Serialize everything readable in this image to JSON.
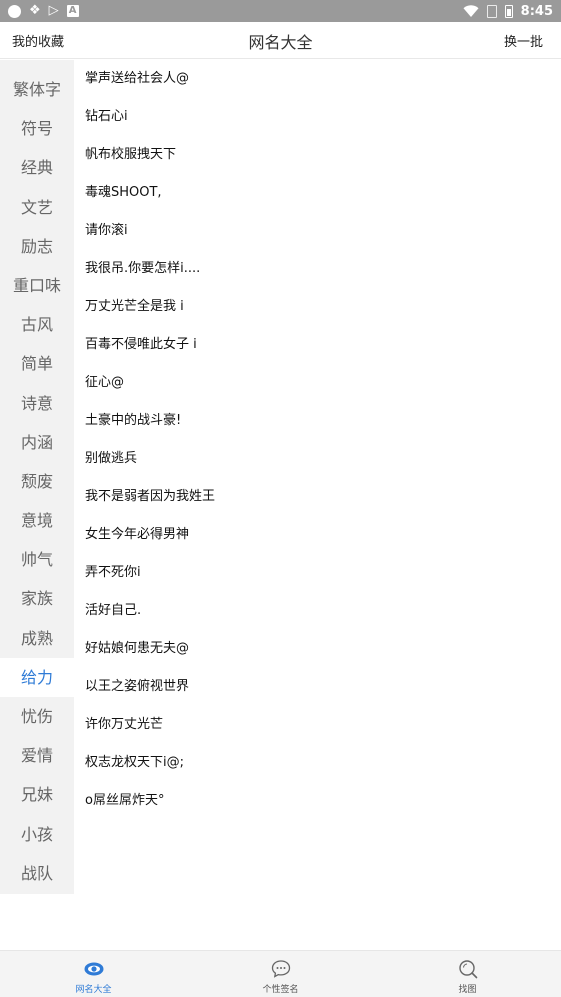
{
  "status_bar": {
    "time": "8:45",
    "left_icons": [
      "circle-icon",
      "app-icon",
      "play-store-icon",
      "a-icon"
    ],
    "right_icons": [
      "wifi-icon",
      "sim-icon",
      "battery-icon"
    ]
  },
  "header": {
    "favorites_label": "我的收藏",
    "title": "网名大全",
    "refresh_label": "换一批"
  },
  "sidebar": {
    "active_index": 15,
    "items": [
      {
        "label": "繁体字"
      },
      {
        "label": "符号"
      },
      {
        "label": "经典"
      },
      {
        "label": "文艺"
      },
      {
        "label": "励志"
      },
      {
        "label": "重口味"
      },
      {
        "label": "古风"
      },
      {
        "label": "简单"
      },
      {
        "label": "诗意"
      },
      {
        "label": "内涵"
      },
      {
        "label": "颓废"
      },
      {
        "label": "意境"
      },
      {
        "label": "帅气"
      },
      {
        "label": "家族"
      },
      {
        "label": "成熟"
      },
      {
        "label": "给力"
      },
      {
        "label": "忧伤"
      },
      {
        "label": "爱情"
      },
      {
        "label": "兄妹"
      },
      {
        "label": "小孩"
      },
      {
        "label": "战队"
      }
    ]
  },
  "names": [
    "掌声送给社会人@",
    "钻石心i",
    "帆布校服拽天下",
    "毒魂SHOOT,",
    "请你滚i",
    "我很吊.你要怎样i....",
    "万丈光芒全是我 i",
    "百毒不侵唯此女子 i",
    "征心@",
    "土豪中的战斗豪!",
    "别做逃兵",
    "我不是弱者因为我姓王",
    "女生今年必得男神",
    "弄不死你i",
    "活好自己.",
    "好姑娘何患无夫@",
    "以王之姿俯视世界",
    "许你万丈光芒",
    "权志龙权天下i@;",
    "o屌丝屌炸天°"
  ],
  "tabs": [
    {
      "label": "网名大全",
      "icon": "eye-icon",
      "active": true
    },
    {
      "label": "个性签名",
      "icon": "chat-bubble-icon",
      "active": false
    },
    {
      "label": "找图",
      "icon": "search-icon",
      "active": false
    }
  ],
  "colors": {
    "accent": "#2f7bd6",
    "status_bar": "#9a9a9a",
    "sidebar_bg": "#f2f2f2",
    "tab_bar_bg": "#f4f4f4"
  }
}
